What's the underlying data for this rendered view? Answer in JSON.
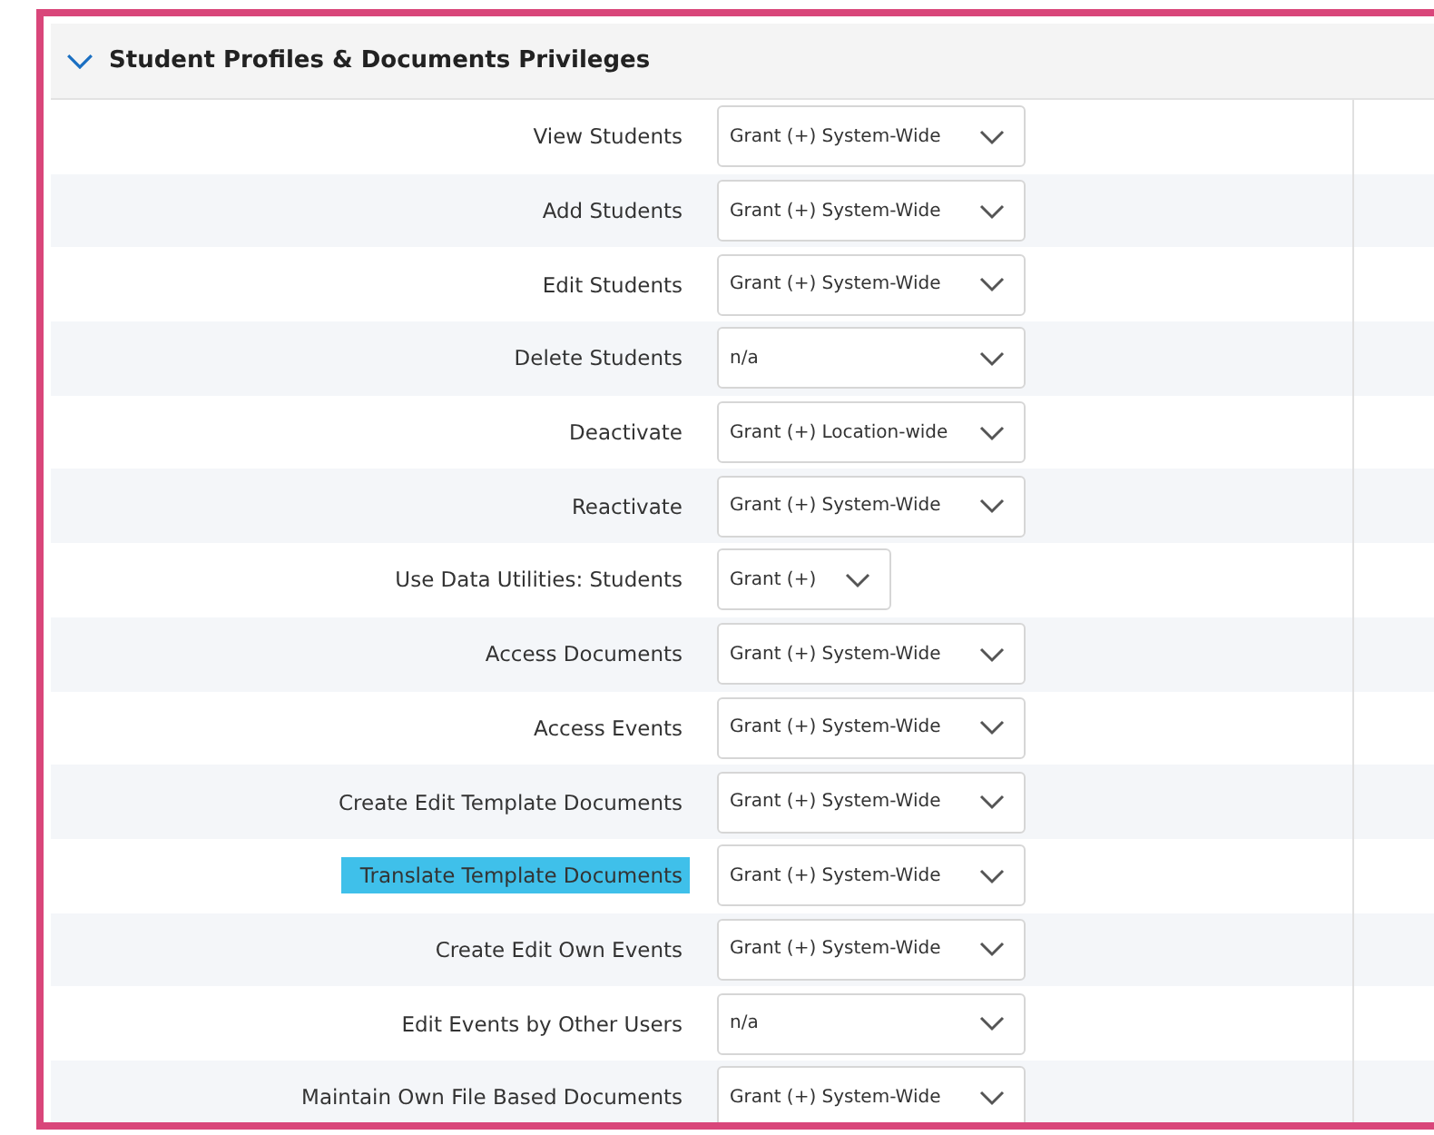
{
  "section": {
    "title": "Student Profiles & Documents Privileges",
    "expanded": true
  },
  "rows": [
    {
      "label": "View Students",
      "value": "Grant (+) System-Wide",
      "kind": "wide",
      "highlighted": false
    },
    {
      "label": "Add Students",
      "value": "Grant (+) System-Wide",
      "kind": "wide",
      "highlighted": false
    },
    {
      "label": "Edit Students",
      "value": "Grant (+) System-Wide",
      "kind": "wide",
      "highlighted": false
    },
    {
      "label": "Delete Students",
      "value": "n/a",
      "kind": "wide",
      "highlighted": false
    },
    {
      "label": "Deactivate",
      "value": "Grant (+) Location-wide",
      "kind": "wide",
      "highlighted": false
    },
    {
      "label": "Reactivate",
      "value": "Grant (+) System-Wide",
      "kind": "wide",
      "highlighted": false
    },
    {
      "label": "Use Data Utilities: Students",
      "value": "Grant (+)",
      "kind": "narrow",
      "highlighted": false
    },
    {
      "label": "Access Documents",
      "value": "Grant (+) System-Wide",
      "kind": "wide",
      "highlighted": false
    },
    {
      "label": "Access Events",
      "value": "Grant (+) System-Wide",
      "kind": "wide",
      "highlighted": false
    },
    {
      "label": "Create Edit Template Documents",
      "value": "Grant (+) System-Wide",
      "kind": "wide",
      "highlighted": false
    },
    {
      "label": "Translate Template Documents",
      "value": "Grant (+) System-Wide",
      "kind": "wide",
      "highlighted": true
    },
    {
      "label": "Create Edit Own Events",
      "value": "Grant (+) System-Wide",
      "kind": "wide",
      "highlighted": false
    },
    {
      "label": "Edit Events by Other Users",
      "value": "n/a",
      "kind": "wide",
      "highlighted": false
    },
    {
      "label": "Maintain Own File Based Documents",
      "value": "Grant (+) System-Wide",
      "kind": "wide",
      "highlighted": false
    }
  ]
}
